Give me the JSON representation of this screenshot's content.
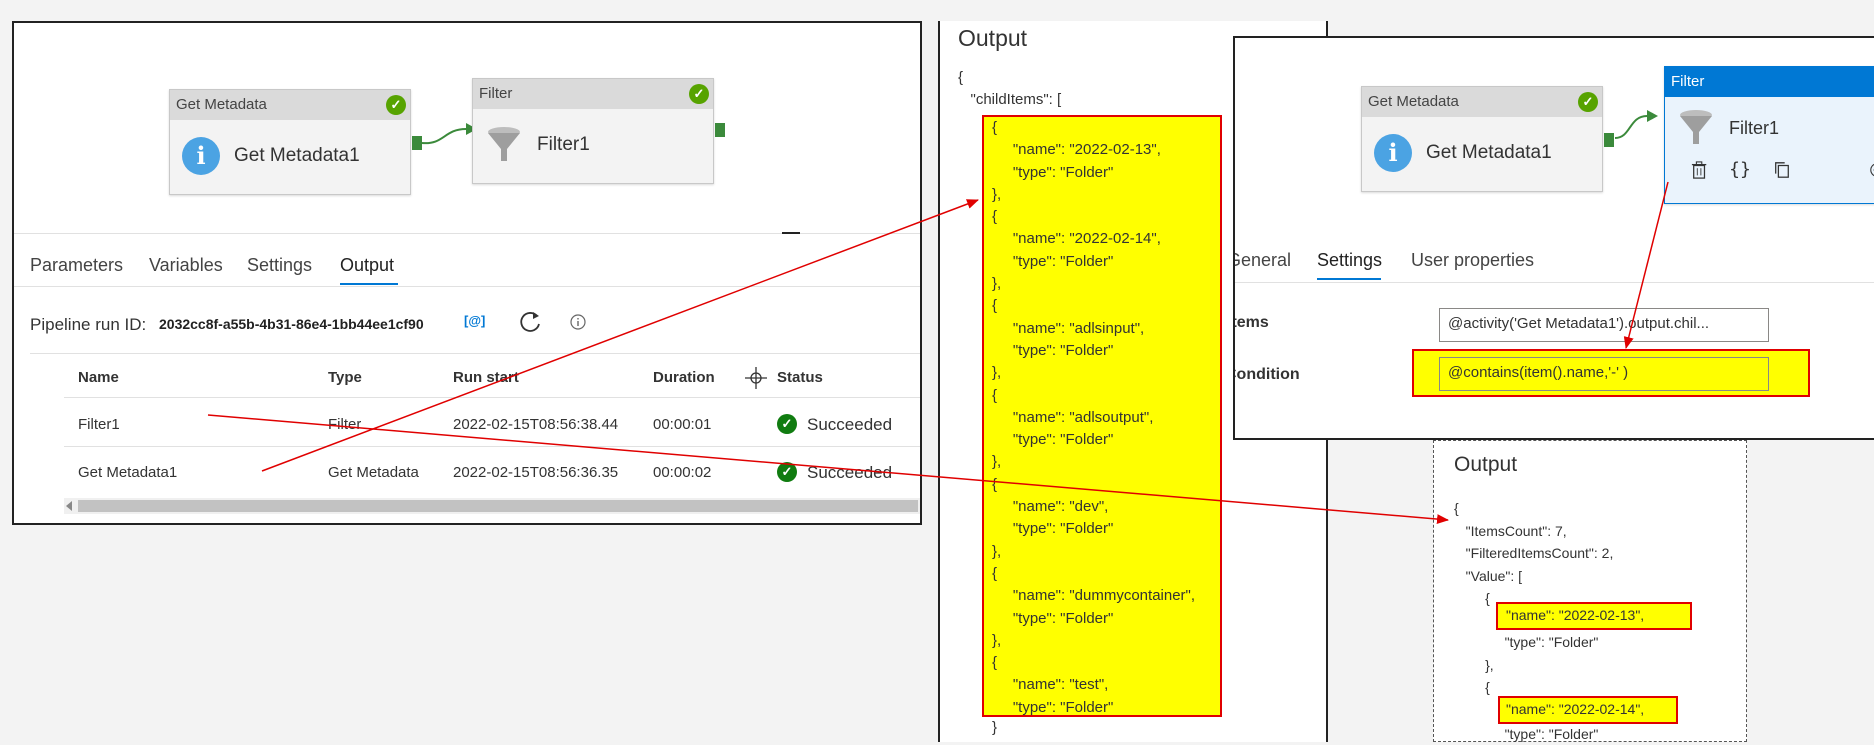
{
  "left_panel": {
    "nodes": {
      "get_metadata": {
        "header": "Get Metadata",
        "name": "Get Metadata1"
      },
      "filter": {
        "header": "Filter",
        "name": "Filter1"
      }
    },
    "tabs": [
      "Parameters",
      "Variables",
      "Settings",
      "Output"
    ],
    "active_tab": "Output",
    "run_id_label": "Pipeline run ID:",
    "run_id": "2032cc8f-a55b-4b31-86e4-1bb44ee1cf90",
    "copy_label": "[@]",
    "columns": [
      "Name",
      "Type",
      "Run start",
      "Duration",
      "Status"
    ],
    "rows": [
      {
        "name": "Filter1",
        "type": "Filter",
        "run_start": "2022-02-15T08:56:38.44",
        "duration": "00:00:01",
        "status": "Succeeded"
      },
      {
        "name": "Get Metadata1",
        "type": "Get Metadata",
        "run_start": "2022-02-15T08:56:36.35",
        "duration": "00:00:02",
        "status": "Succeeded"
      }
    ]
  },
  "middle_panel": {
    "title": "Output",
    "open_line": "{\n   \"childItems\": [",
    "items_json": "{\n     \"name\": \"2022-02-13\",\n     \"type\": \"Folder\"\n},\n{\n     \"name\": \"2022-02-14\",\n     \"type\": \"Folder\"\n},\n{\n     \"name\": \"adlsinput\",\n     \"type\": \"Folder\"\n},\n{\n     \"name\": \"adlsoutput\",\n     \"type\": \"Folder\"\n},\n{\n     \"name\": \"dev\",\n     \"type\": \"Folder\"\n},\n{\n     \"name\": \"dummycontainer\",\n     \"type\": \"Folder\"\n},\n{\n     \"name\": \"test\",\n     \"type\": \"Folder\"",
    "close_line": "}"
  },
  "right_panel": {
    "nodes": {
      "get_metadata": {
        "header": "Get Metadata",
        "name": "Get Metadata1"
      },
      "filter": {
        "header": "Filter",
        "name": "Filter1"
      }
    },
    "tabs": [
      "General",
      "Settings",
      "User properties"
    ],
    "active_tab": "Settings",
    "items_label": "Items",
    "items_value": "@activity('Get Metadata1').output.chil...",
    "condition_label": "Condition",
    "condition_value": "@contains(item().name,'-' )"
  },
  "output_box": {
    "title": "Output",
    "json_top": "{\n   \"ItemsCount\": 7,\n   \"FilteredItemsCount\": 2,\n   \"Value\": [\n        {",
    "hl1": "\"name\": \"2022-02-13\",",
    "mid": "             \"type\": \"Folder\"\n        },\n        {",
    "hl2": "\"name\": \"2022-02-14\",",
    "bottom": "             \"type\": \"Folder\""
  },
  "colors": {
    "highlight": "#ffff00",
    "annotation": "#e00000",
    "success": "#107c10",
    "accent": "#0078d4"
  }
}
